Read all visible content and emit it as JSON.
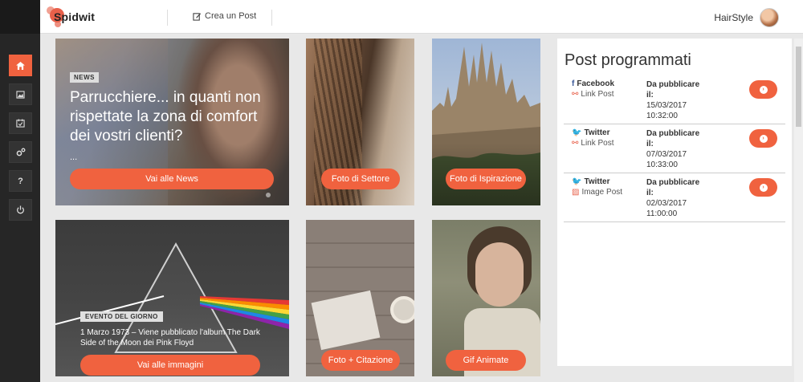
{
  "header": {
    "logo_text": "Spidwit",
    "new_post_label": "Crea un Post",
    "user_name": "HairStyle"
  },
  "sidebar": {
    "items": [
      {
        "icon": "home-icon",
        "glyph": "⌂",
        "active": true
      },
      {
        "icon": "gallery-icon",
        "glyph": "▣"
      },
      {
        "icon": "calendar-icon",
        "glyph": "☑"
      },
      {
        "icon": "settings-icon",
        "glyph": "⚙"
      },
      {
        "icon": "help-icon",
        "glyph": "?"
      },
      {
        "icon": "power-icon",
        "glyph": "⏻"
      }
    ]
  },
  "tiles": {
    "news": {
      "badge": "NEWS",
      "title": "Parrucchiere... in quanti non rispettate la zona di comfort dei vostri clienti?",
      "more": "...",
      "button": "Vai alle News"
    },
    "settore": {
      "button": "Foto di Settore"
    },
    "ispirazione": {
      "button": "Foto di Ispirazione"
    },
    "evento": {
      "badge": "EVENTO DEL GIORNO",
      "text": "1 Marzo 1973 – Viene pubblicato l'album The Dark Side of the Moon dei Pink Floyd",
      "button": "Vai alle immagini"
    },
    "citazione": {
      "button": "Foto + Citazione"
    },
    "gif": {
      "button": "Gif Animate"
    }
  },
  "panel": {
    "title": "Post programmati",
    "posts": [
      {
        "network": "Facebook",
        "type": "Link Post",
        "label": "Da pubblicare il:",
        "date": "15/03/2017",
        "time": "10:32:00"
      },
      {
        "network": "Twitter",
        "type": "Link Post",
        "label": "Da pubblicare il:",
        "date": "07/03/2017",
        "time": "10:33:00"
      },
      {
        "network": "Twitter",
        "type": "Image Post",
        "label": "Da pubblicare il:",
        "date": "02/03/2017",
        "time": "11:00:00"
      }
    ]
  },
  "colors": {
    "accent": "#f0623f",
    "sidebar": "#262626"
  }
}
